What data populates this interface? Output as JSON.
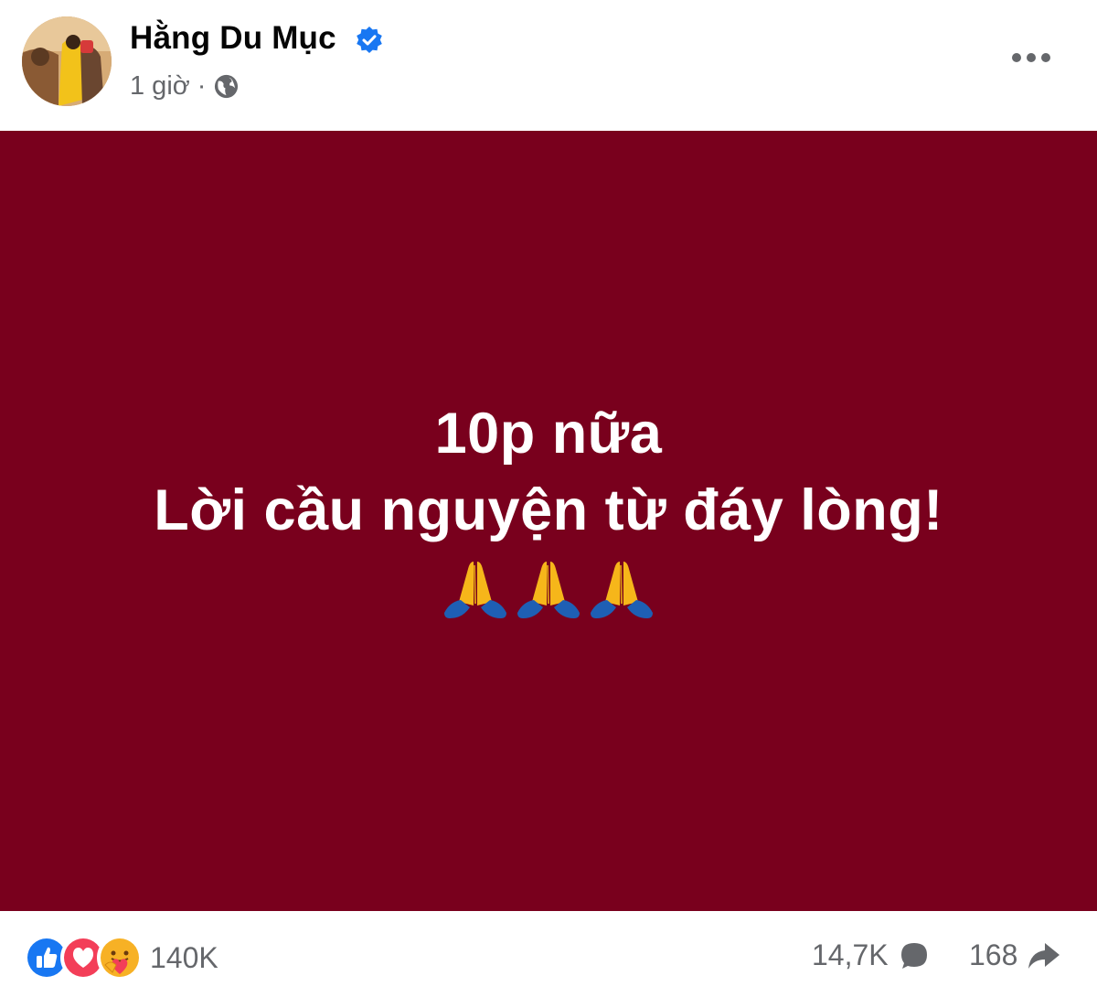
{
  "post": {
    "author": {
      "name": "Hằng Du Mục",
      "verified": true
    },
    "time": "1 giờ",
    "separator": "·",
    "privacy_icon": "globe-icon",
    "more_icon": "more-options-icon",
    "background_color": "#79001d",
    "text_lines": [
      "10p nữa",
      "Lời cầu nguyện từ đáy lòng!"
    ],
    "emoji": [
      "folded-hands",
      "folded-hands",
      "folded-hands"
    ]
  },
  "footer": {
    "reaction_icons": [
      "like-icon",
      "love-icon",
      "care-icon"
    ],
    "reaction_count": "140K",
    "comment_count": "14,7K",
    "share_count": "168"
  },
  "colors": {
    "verified": "#1877f2",
    "meta_text": "#65676b",
    "like": "#1877f2",
    "love": "#f33e58"
  }
}
